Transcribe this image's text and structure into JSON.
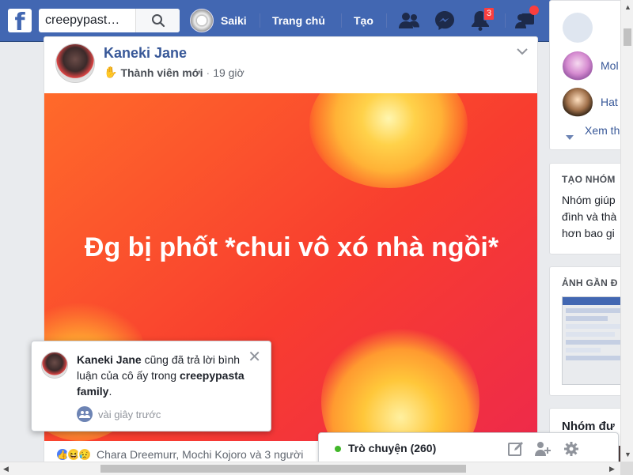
{
  "topbar": {
    "logo": "f",
    "search_value": "creepypast…",
    "profile_name": "Saiki",
    "nav_home": "Trang chủ",
    "nav_create": "Tạo",
    "notifications_count": "3",
    "icons": [
      "friend-requests-icon",
      "messenger-icon",
      "notifications-icon",
      "groups-icon",
      "help-icon",
      "account-menu-icon"
    ]
  },
  "post": {
    "author": "Kaneki Jane",
    "role": "Thành viên mới",
    "separator": "·",
    "time": "19 giờ",
    "banner_text": "Đg bị phốt *chui vô xó nhà ngồi*",
    "reactions_text": "Chara Dreemurr, Mochi Kojoro và 3 người",
    "reaction_types": [
      "like",
      "haha",
      "sad"
    ],
    "colors": {
      "banner_start": "#ff6a2a",
      "banner_end": "#ee2a4a"
    }
  },
  "sidebar": {
    "members": [
      {
        "name": "Mol"
      },
      {
        "name": "Hat"
      }
    ],
    "see_more": "Xem th",
    "create_group": {
      "heading": "TẠO NHÓM",
      "lines": [
        "Nhóm giúp",
        "đình và thà",
        "hơn bao gi"
      ]
    },
    "recent_photos": {
      "heading": "ẢNH GẦN Đ"
    },
    "suggested_groups": {
      "heading": "Nhóm đư"
    }
  },
  "notification": {
    "actor": "Kaneki Jane",
    "text_middle": " cũng đã trả lời bình luận của cô ấy trong ",
    "group": "creepypasta family",
    "text_end": ".",
    "time": "vài giây trước"
  },
  "chat": {
    "label": "Trò chuyện (260)",
    "status_color": "#42b72a"
  }
}
